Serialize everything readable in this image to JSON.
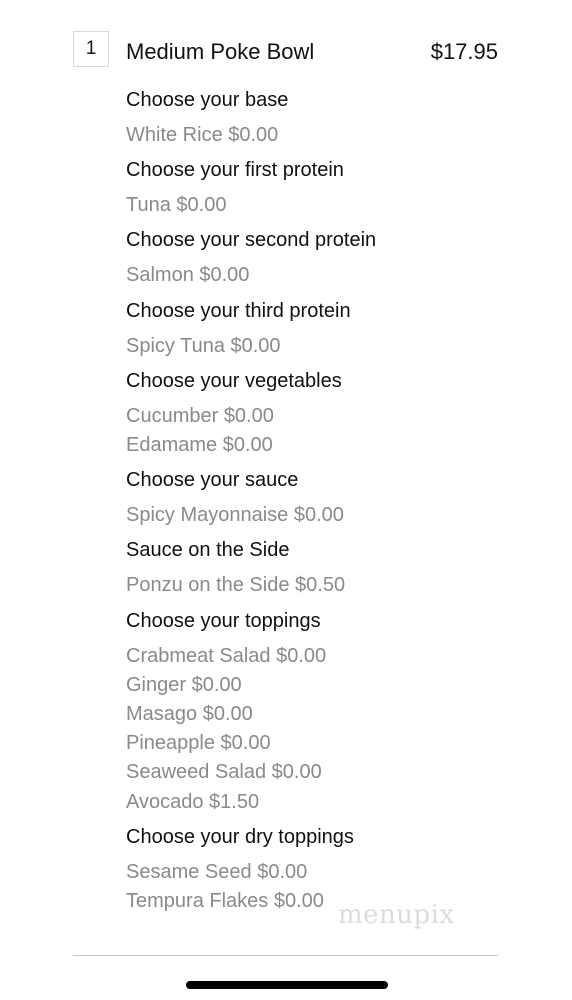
{
  "item": {
    "quantity": "1",
    "name": "Medium Poke Bowl",
    "price": "$17.95"
  },
  "groups": [
    {
      "title": "Choose your base",
      "choices": [
        "White Rice $0.00"
      ]
    },
    {
      "title": "Choose your first protein",
      "choices": [
        "Tuna $0.00"
      ]
    },
    {
      "title": "Choose your second protein",
      "choices": [
        "Salmon $0.00"
      ]
    },
    {
      "title": "Choose your third protein",
      "choices": [
        "Spicy Tuna $0.00"
      ]
    },
    {
      "title": "Choose your vegetables",
      "choices": [
        "Cucumber $0.00",
        "Edamame $0.00"
      ]
    },
    {
      "title": "Choose your sauce",
      "choices": [
        "Spicy Mayonnaise $0.00"
      ]
    },
    {
      "title": "Sauce on the Side",
      "choices": [
        "Ponzu on the Side $0.50"
      ]
    },
    {
      "title": "Choose your toppings",
      "choices": [
        "Crabmeat Salad $0.00",
        "Ginger $0.00",
        "Masago $0.00",
        "Pineapple $0.00",
        "Seaweed Salad $0.00",
        "Avocado $1.50"
      ]
    },
    {
      "title": "Choose your dry toppings",
      "choices": [
        "Sesame Seed $0.00",
        "Tempura Flakes $0.00"
      ]
    }
  ],
  "watermark": "menupix"
}
